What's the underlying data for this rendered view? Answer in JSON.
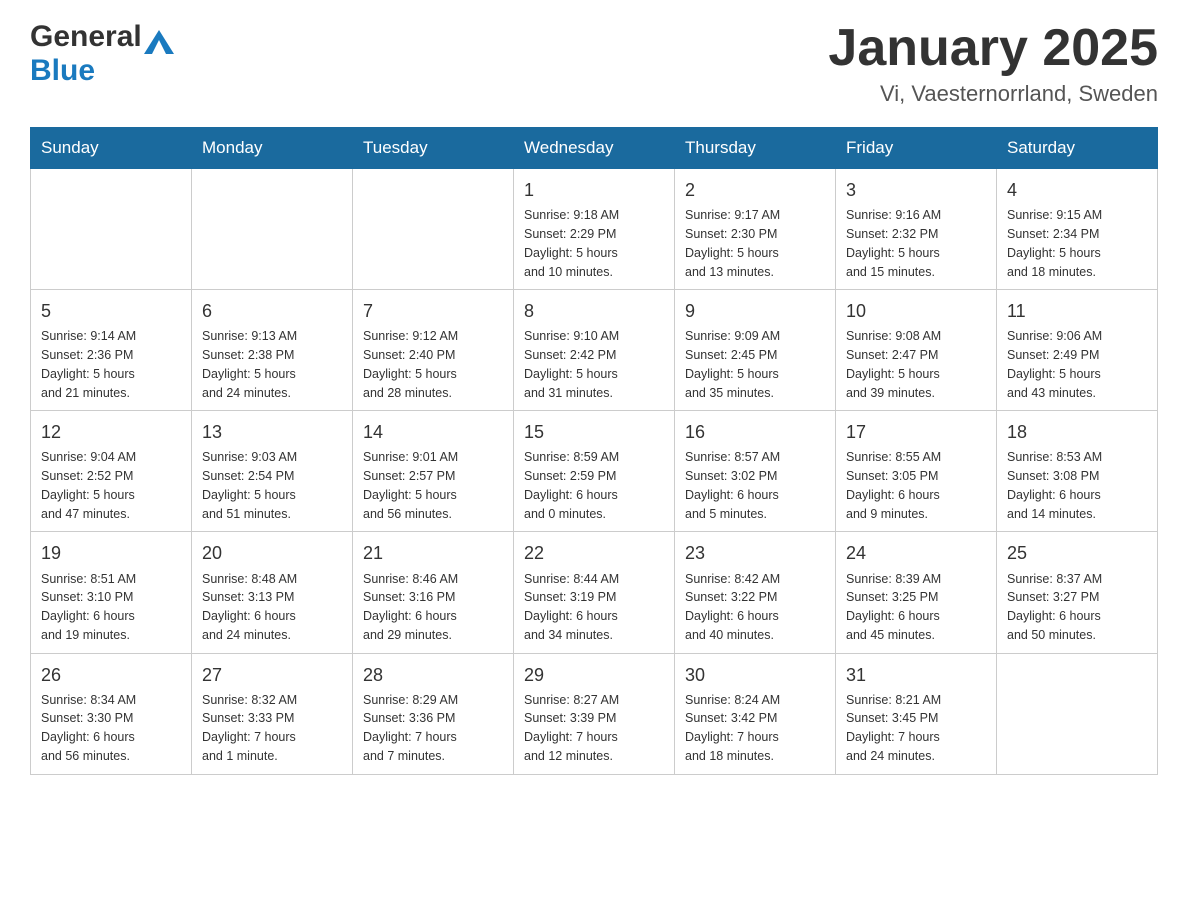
{
  "header": {
    "logo_general": "General",
    "logo_blue": "Blue",
    "title": "January 2025",
    "location": "Vi, Vaesternorrland, Sweden"
  },
  "days_of_week": [
    "Sunday",
    "Monday",
    "Tuesday",
    "Wednesday",
    "Thursday",
    "Friday",
    "Saturday"
  ],
  "weeks": [
    [
      {
        "day": "",
        "info": ""
      },
      {
        "day": "",
        "info": ""
      },
      {
        "day": "",
        "info": ""
      },
      {
        "day": "1",
        "info": "Sunrise: 9:18 AM\nSunset: 2:29 PM\nDaylight: 5 hours\nand 10 minutes."
      },
      {
        "day": "2",
        "info": "Sunrise: 9:17 AM\nSunset: 2:30 PM\nDaylight: 5 hours\nand 13 minutes."
      },
      {
        "day": "3",
        "info": "Sunrise: 9:16 AM\nSunset: 2:32 PM\nDaylight: 5 hours\nand 15 minutes."
      },
      {
        "day": "4",
        "info": "Sunrise: 9:15 AM\nSunset: 2:34 PM\nDaylight: 5 hours\nand 18 minutes."
      }
    ],
    [
      {
        "day": "5",
        "info": "Sunrise: 9:14 AM\nSunset: 2:36 PM\nDaylight: 5 hours\nand 21 minutes."
      },
      {
        "day": "6",
        "info": "Sunrise: 9:13 AM\nSunset: 2:38 PM\nDaylight: 5 hours\nand 24 minutes."
      },
      {
        "day": "7",
        "info": "Sunrise: 9:12 AM\nSunset: 2:40 PM\nDaylight: 5 hours\nand 28 minutes."
      },
      {
        "day": "8",
        "info": "Sunrise: 9:10 AM\nSunset: 2:42 PM\nDaylight: 5 hours\nand 31 minutes."
      },
      {
        "day": "9",
        "info": "Sunrise: 9:09 AM\nSunset: 2:45 PM\nDaylight: 5 hours\nand 35 minutes."
      },
      {
        "day": "10",
        "info": "Sunrise: 9:08 AM\nSunset: 2:47 PM\nDaylight: 5 hours\nand 39 minutes."
      },
      {
        "day": "11",
        "info": "Sunrise: 9:06 AM\nSunset: 2:49 PM\nDaylight: 5 hours\nand 43 minutes."
      }
    ],
    [
      {
        "day": "12",
        "info": "Sunrise: 9:04 AM\nSunset: 2:52 PM\nDaylight: 5 hours\nand 47 minutes."
      },
      {
        "day": "13",
        "info": "Sunrise: 9:03 AM\nSunset: 2:54 PM\nDaylight: 5 hours\nand 51 minutes."
      },
      {
        "day": "14",
        "info": "Sunrise: 9:01 AM\nSunset: 2:57 PM\nDaylight: 5 hours\nand 56 minutes."
      },
      {
        "day": "15",
        "info": "Sunrise: 8:59 AM\nSunset: 2:59 PM\nDaylight: 6 hours\nand 0 minutes."
      },
      {
        "day": "16",
        "info": "Sunrise: 8:57 AM\nSunset: 3:02 PM\nDaylight: 6 hours\nand 5 minutes."
      },
      {
        "day": "17",
        "info": "Sunrise: 8:55 AM\nSunset: 3:05 PM\nDaylight: 6 hours\nand 9 minutes."
      },
      {
        "day": "18",
        "info": "Sunrise: 8:53 AM\nSunset: 3:08 PM\nDaylight: 6 hours\nand 14 minutes."
      }
    ],
    [
      {
        "day": "19",
        "info": "Sunrise: 8:51 AM\nSunset: 3:10 PM\nDaylight: 6 hours\nand 19 minutes."
      },
      {
        "day": "20",
        "info": "Sunrise: 8:48 AM\nSunset: 3:13 PM\nDaylight: 6 hours\nand 24 minutes."
      },
      {
        "day": "21",
        "info": "Sunrise: 8:46 AM\nSunset: 3:16 PM\nDaylight: 6 hours\nand 29 minutes."
      },
      {
        "day": "22",
        "info": "Sunrise: 8:44 AM\nSunset: 3:19 PM\nDaylight: 6 hours\nand 34 minutes."
      },
      {
        "day": "23",
        "info": "Sunrise: 8:42 AM\nSunset: 3:22 PM\nDaylight: 6 hours\nand 40 minutes."
      },
      {
        "day": "24",
        "info": "Sunrise: 8:39 AM\nSunset: 3:25 PM\nDaylight: 6 hours\nand 45 minutes."
      },
      {
        "day": "25",
        "info": "Sunrise: 8:37 AM\nSunset: 3:27 PM\nDaylight: 6 hours\nand 50 minutes."
      }
    ],
    [
      {
        "day": "26",
        "info": "Sunrise: 8:34 AM\nSunset: 3:30 PM\nDaylight: 6 hours\nand 56 minutes."
      },
      {
        "day": "27",
        "info": "Sunrise: 8:32 AM\nSunset: 3:33 PM\nDaylight: 7 hours\nand 1 minute."
      },
      {
        "day": "28",
        "info": "Sunrise: 8:29 AM\nSunset: 3:36 PM\nDaylight: 7 hours\nand 7 minutes."
      },
      {
        "day": "29",
        "info": "Sunrise: 8:27 AM\nSunset: 3:39 PM\nDaylight: 7 hours\nand 12 minutes."
      },
      {
        "day": "30",
        "info": "Sunrise: 8:24 AM\nSunset: 3:42 PM\nDaylight: 7 hours\nand 18 minutes."
      },
      {
        "day": "31",
        "info": "Sunrise: 8:21 AM\nSunset: 3:45 PM\nDaylight: 7 hours\nand 24 minutes."
      },
      {
        "day": "",
        "info": ""
      }
    ]
  ]
}
